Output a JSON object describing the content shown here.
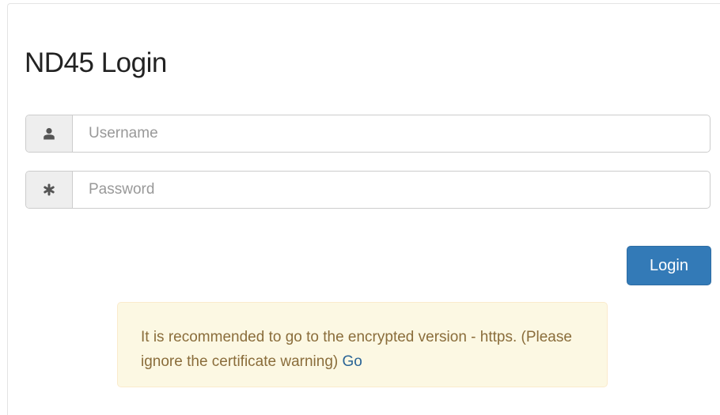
{
  "page": {
    "title": "ND45 Login"
  },
  "form": {
    "username": {
      "value": "",
      "placeholder": "Username",
      "icon": "user-icon"
    },
    "password": {
      "value": "",
      "placeholder": "Password",
      "icon": "asterisk-icon"
    },
    "login_label": "Login"
  },
  "alert": {
    "message": "It is recommended to go to the encrypted version - https. (Please ignore the certificate warning)",
    "link_label": "Go"
  },
  "colors": {
    "primary": "#337ab7",
    "alert_bg": "#fcf8e3",
    "alert_text": "#8a6d3b",
    "addon_bg": "#eeeeee"
  }
}
